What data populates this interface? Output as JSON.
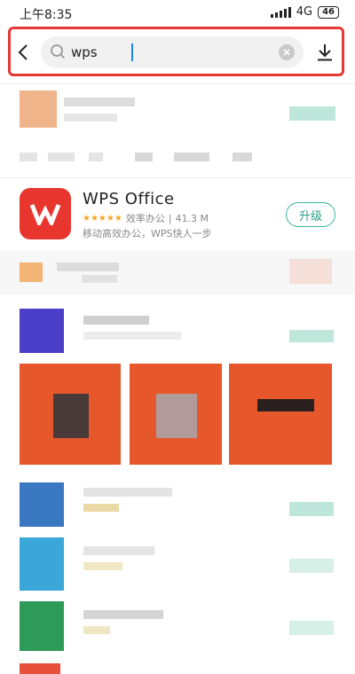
{
  "status_bar": {
    "time": "上午8:35",
    "network": "4G",
    "battery": "46"
  },
  "search": {
    "query": "wps",
    "back_icon": "chevron-left-icon",
    "clear_icon": "clear-icon",
    "download_icon": "download-icon"
  },
  "featured_app": {
    "name": "WPS Office",
    "stars": "★★★★★",
    "category": "效率办公",
    "size": "41.3 M",
    "description": "移动高效办公，WPS快人一步",
    "action_label": "升级",
    "icon": "wps-logo-icon"
  },
  "colors": {
    "highlight": "#e53935",
    "wps_red": "#e8362f",
    "accent_green": "#3bb5a0",
    "star": "#f5a623"
  }
}
